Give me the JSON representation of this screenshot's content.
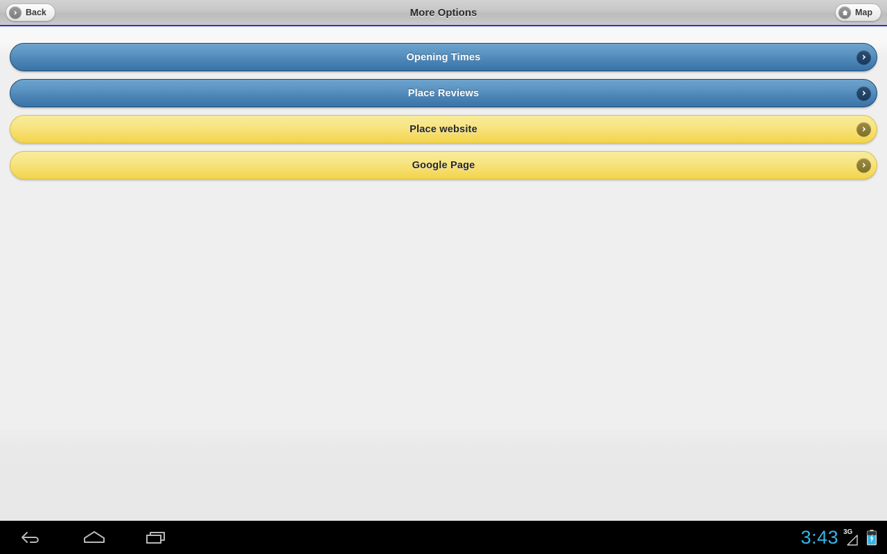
{
  "header": {
    "title": "More Options",
    "back_button": {
      "label": "Back",
      "icon": "circle-arrow-right-icon"
    },
    "map_button": {
      "label": "Map",
      "icon": "home-icon"
    }
  },
  "main": {
    "buttons": [
      {
        "label": "Opening Times",
        "style": "blue",
        "chevron": "chevron-right-icon"
      },
      {
        "label": "Place Reviews",
        "style": "blue",
        "chevron": "chevron-right-icon"
      },
      {
        "label": "Place website",
        "style": "yellow",
        "chevron": "chevron-right-icon"
      },
      {
        "label": "Google Page",
        "style": "yellow",
        "chevron": "chevron-right-icon"
      }
    ]
  },
  "system_bar": {
    "back_icon": "back-arrow-icon",
    "home_icon": "home-pentagon-icon",
    "recents_icon": "recent-apps-icon",
    "clock": "3:43",
    "network": "3G",
    "signal_icon": "signal-triangle-icon",
    "battery_icon": "battery-charging-icon"
  },
  "colors": {
    "accent_blue": "#4a83b4",
    "accent_yellow": "#f6dc64",
    "header_separator": "#2d2de0",
    "status_accent": "#33b5e5",
    "background": "#efefef"
  }
}
